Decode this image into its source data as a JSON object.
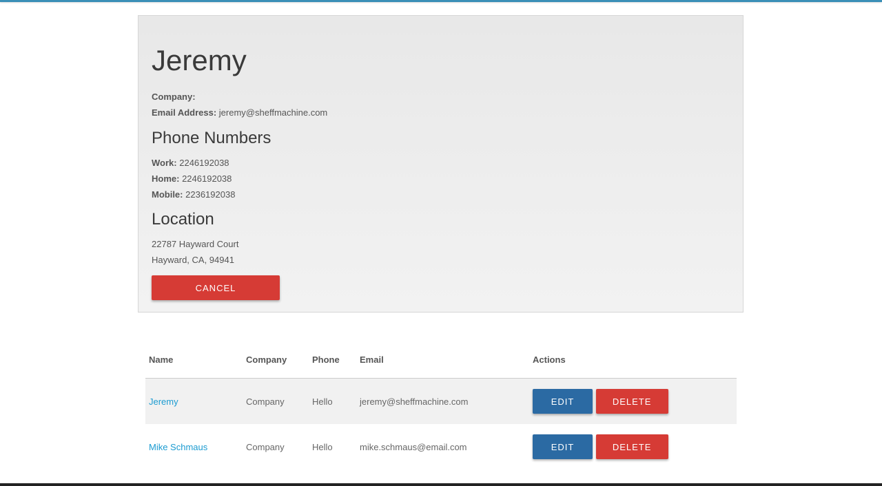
{
  "contact": {
    "name": "Jeremy",
    "company_label": "Company:",
    "company_value": "",
    "email_label": "Email Address:",
    "email_value": "jeremy@sheffmachine.com",
    "phone_heading": "Phone Numbers",
    "phones": [
      {
        "label": "Work:",
        "value": "2246192038"
      },
      {
        "label": "Home:",
        "value": "2246192038"
      },
      {
        "label": "Mobile:",
        "value": "2236192038"
      }
    ],
    "location_heading": "Location",
    "address_line1": "22787 Hayward Court",
    "address_line2": "Hayward, CA, 94941",
    "cancel_label": "CANCEL"
  },
  "table": {
    "headers": [
      "Name",
      "Company",
      "Phone",
      "Email",
      "Actions"
    ],
    "rows": [
      {
        "name": "Jeremy",
        "company": "Company",
        "phone": "Hello",
        "email": "jeremy@sheffmachine.com",
        "edit_label": "EDIT",
        "delete_label": "DELETE"
      },
      {
        "name": "Mike Schmaus",
        "company": "Company",
        "phone": "Hello",
        "email": "mike.schmaus@email.com",
        "edit_label": "EDIT",
        "delete_label": "DELETE"
      }
    ]
  },
  "colors": {
    "accent": "#3a8fb7",
    "primary_button": "#2b6aa3",
    "danger_button": "#d63b35",
    "link": "#1b9bd1"
  }
}
